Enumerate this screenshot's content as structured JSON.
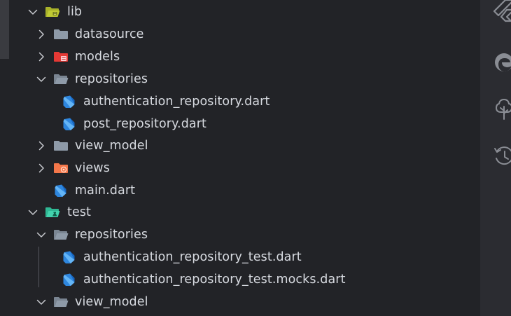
{
  "explorer": {
    "items": [
      {
        "label": "lib",
        "kind": "folder",
        "state": "expanded",
        "icon": "lib-folder-open-icon"
      },
      {
        "label": "datasource",
        "kind": "folder",
        "state": "collapsed",
        "icon": "folder-icon"
      },
      {
        "label": "models",
        "kind": "folder",
        "state": "collapsed",
        "icon": "models-folder-icon"
      },
      {
        "label": "repositories",
        "kind": "folder",
        "state": "expanded",
        "icon": "folder-open-icon"
      },
      {
        "label": "authentication_repository.dart",
        "kind": "file",
        "icon": "dart-file-icon"
      },
      {
        "label": "post_repository.dart",
        "kind": "file",
        "icon": "dart-file-icon"
      },
      {
        "label": "view_model",
        "kind": "folder",
        "state": "collapsed",
        "icon": "folder-icon"
      },
      {
        "label": "views",
        "kind": "folder",
        "state": "collapsed",
        "icon": "views-folder-icon"
      },
      {
        "label": "main.dart",
        "kind": "file",
        "icon": "dart-file-icon"
      },
      {
        "label": "test",
        "kind": "folder",
        "state": "expanded",
        "icon": "test-folder-open-icon"
      },
      {
        "label": "repositories",
        "kind": "folder",
        "state": "expanded",
        "icon": "folder-open-icon"
      },
      {
        "label": "authentication_repository_test.dart",
        "kind": "file",
        "icon": "dart-file-icon"
      },
      {
        "label": "authentication_repository_test.mocks.dart",
        "kind": "file",
        "icon": "dart-file-icon"
      },
      {
        "label": "view_model",
        "kind": "folder",
        "state": "expanded",
        "icon": "folder-open-icon"
      }
    ]
  },
  "activity_bar": {
    "icons": [
      "flutter-icon",
      "edge-browser-icon",
      "tree-icon",
      "history-icon"
    ]
  },
  "colors": {
    "background": "#222327",
    "activity_bar": "#2b2c31",
    "text": "#d7dae0",
    "chevron": "#c8cacf",
    "folder_gray": "#8e9aa8",
    "lib_folder": "#c0ca33",
    "models_folder": "#e53935",
    "views_folder": "#f4774a",
    "test_folder": "#42d3ad",
    "dart_blue": "#5aa6ea"
  }
}
